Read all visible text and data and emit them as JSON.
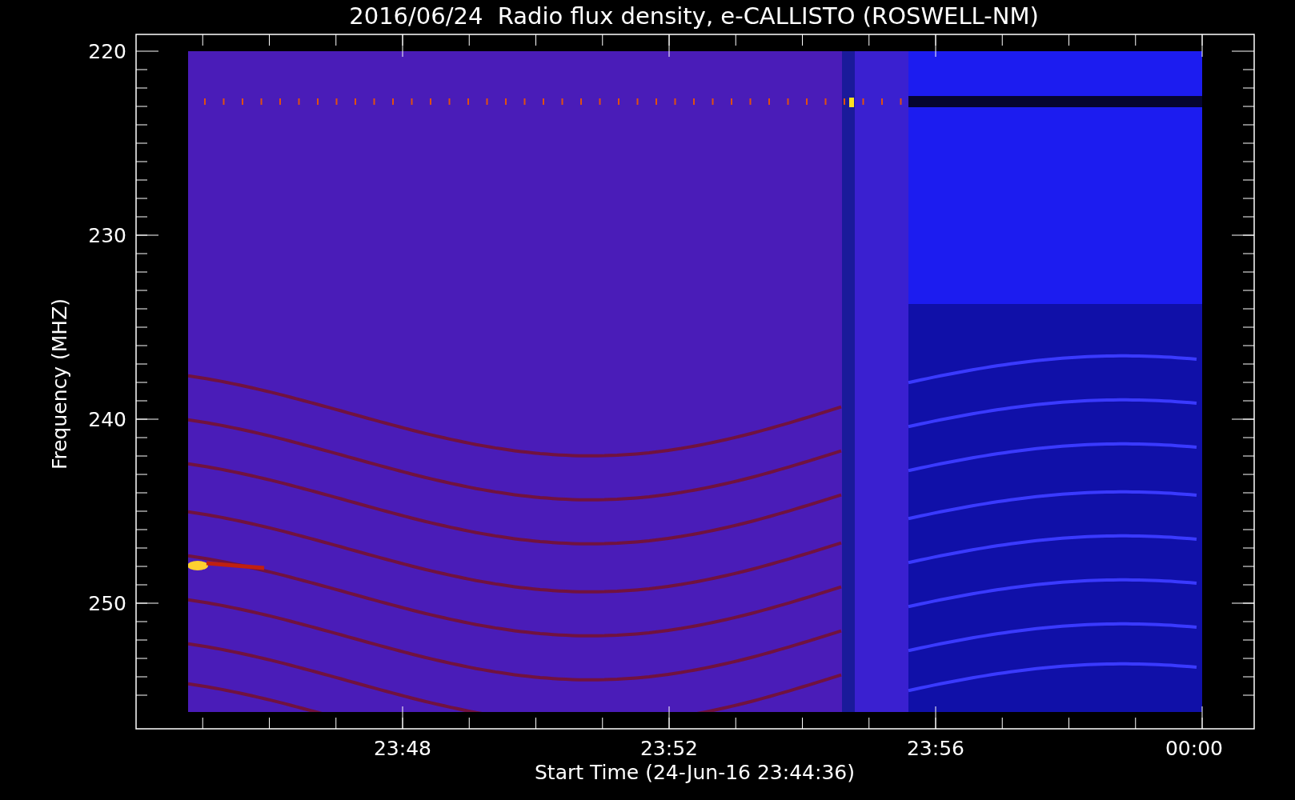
{
  "title": "2016/06/24  Radio flux density, e-CALLISTO (ROSWELL-NM)",
  "y_axis": {
    "label": "Frequency (MHZ)",
    "ticks": [
      "220",
      "230",
      "240",
      "250"
    ]
  },
  "x_axis": {
    "label": "Start Time (24-Jun-16 23:44:36)",
    "ticks": [
      "23:48",
      "23:52",
      "23:56",
      "00:00"
    ]
  }
}
